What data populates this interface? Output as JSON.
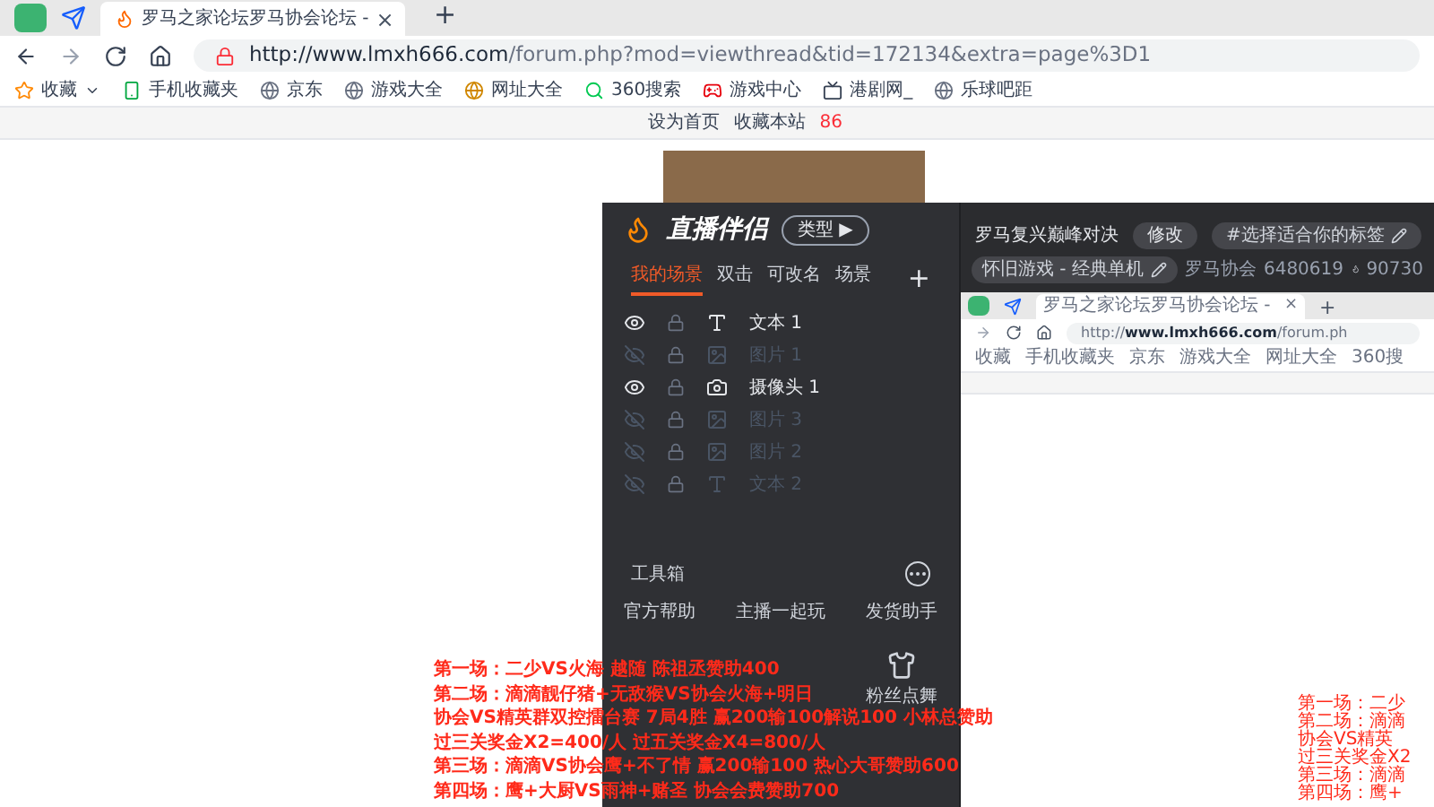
{
  "browser": {
    "tabs": [
      {
        "title": "罗马之家论坛罗马协会论坛 - ",
        "selected": true
      }
    ],
    "close": "×",
    "new_tab": "+",
    "url": {
      "host": "http://www.lmxh666.com",
      "path": "/forum.php?mod=viewthread&tid=172134&extra=page%3D1"
    },
    "bookmarks": [
      {
        "label": "收藏",
        "kind": "star"
      },
      {
        "label": "手机收藏夹",
        "kind": "phone"
      },
      {
        "label": "京东",
        "kind": "globe"
      },
      {
        "label": "游戏大全",
        "kind": "globe"
      },
      {
        "label": "网址大全",
        "kind": "round"
      },
      {
        "label": "360搜索",
        "kind": "search"
      },
      {
        "label": "游戏中心",
        "kind": "game"
      },
      {
        "label": "港剧网_",
        "kind": "tv"
      },
      {
        "label": "乐球吧距",
        "kind": "globe"
      }
    ]
  },
  "page": {
    "links": [
      "设为首页",
      "收藏本站"
    ],
    "count": "86"
  },
  "app": {
    "logo": "直播伴侣",
    "type_button": "类型 ▶",
    "tabs": [
      {
        "label": "我的场景",
        "selected": true
      },
      {
        "label": "双击",
        "selected": false
      },
      {
        "label": "可改名",
        "selected": false
      },
      {
        "label": "场景",
        "selected": false
      }
    ],
    "add": "+",
    "sources": [
      {
        "name": "文本 1",
        "kind": "text",
        "visible": true
      },
      {
        "name": "图片 1",
        "kind": "image",
        "visible": false
      },
      {
        "name": "摄像头 1",
        "kind": "camera",
        "visible": true
      },
      {
        "name": "图片 3",
        "kind": "image",
        "visible": false
      },
      {
        "name": "图片 2",
        "kind": "image",
        "visible": false
      },
      {
        "name": "文本 2",
        "kind": "text",
        "visible": false
      }
    ],
    "toolbox": "工具箱",
    "tools": [
      "官方帮助",
      "主播一起玩",
      "发货助手"
    ],
    "tools2": [
      "粉丝点舞"
    ],
    "stream": {
      "title": "罗马复兴巅峰对决",
      "edit": "修改",
      "tag": "#选择适合你的标签",
      "category": "怀旧游戏 - 经典单机",
      "name": "罗马协会",
      "id": "6480619",
      "fans": "90730"
    },
    "preview": {
      "tab": "罗马之家论坛罗马协会论坛 -",
      "close": "×",
      "new_tab": "+",
      "url_prefix": "http://",
      "url_host": "www.lmxh666.com",
      "url_path": "/forum.ph",
      "bookmarks": [
        "收藏",
        "手机收藏夹",
        "京东",
        "游戏大全",
        "网址大全",
        "360搜"
      ]
    }
  },
  "overlay": [
    "第一场：二少VS火海 越随 陈祖丞赞助400",
    "第二场：滴滴靓仔猪+无敌猴VS协会火海+明日",
    "协会VS精英群双控擂台赛 7局4胜 赢200输100解说100 小林总赞助",
    "过三关奖金X2=400/人 过五关奖金X4=800/人",
    "第三场：滴滴VS协会鹰+不了情 赢200输100 热心大哥赞助600",
    "第四场：鹰+大厨VS雨神+赌圣 协会会费赞助700"
  ],
  "overlay_mirror": [
    "第一场：二少",
    "第二场：滴滴",
    "协会VS精英",
    "过三关奖金X2",
    "第三场：滴滴",
    "第四场：鹰+"
  ]
}
